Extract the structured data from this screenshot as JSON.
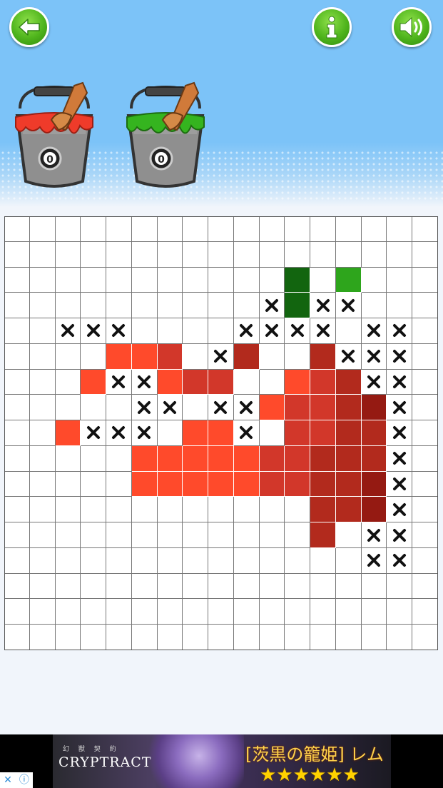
{
  "header": {
    "back_icon": "back-arrow-icon",
    "info_icon": "info-icon",
    "sound_icon": "speaker-icon"
  },
  "buckets": [
    {
      "name": "red-paint-bucket",
      "paint_color": "#ef3b2a",
      "label": "0"
    },
    {
      "name": "green-paint-bucket",
      "paint_color": "#35b41f",
      "label": "0"
    }
  ],
  "board": {
    "rows": 17,
    "cols": 17,
    "cell_colors": [
      [
        "",
        "",
        "",
        "",
        "",
        "",
        "",
        "",
        "",
        "",
        "",
        "",
        "",
        "",
        "",
        "",
        ""
      ],
      [
        "",
        "",
        "",
        "",
        "",
        "",
        "",
        "",
        "",
        "",
        "",
        "",
        "",
        "",
        "",
        "",
        ""
      ],
      [
        "",
        "",
        "",
        "",
        "",
        "",
        "",
        "",
        "",
        "",
        "",
        "g1",
        "",
        "g2",
        "",
        "",
        ""
      ],
      [
        "",
        "",
        "",
        "",
        "",
        "",
        "",
        "",
        "",
        "",
        "x",
        "g1",
        "x",
        "x",
        "",
        "",
        ""
      ],
      [
        "",
        "",
        "x",
        "x",
        "x",
        "",
        "",
        "",
        "",
        "x",
        "x",
        "x",
        "x",
        "",
        "x",
        "x",
        ""
      ],
      [
        "",
        "",
        "",
        "",
        "r1",
        "r1",
        "r2",
        "",
        "x",
        "r3",
        "",
        "",
        "r3",
        "x",
        "x",
        "x",
        ""
      ],
      [
        "",
        "",
        "",
        "r1",
        "x",
        "x",
        "r1",
        "r2",
        "r2",
        "",
        "",
        "r1",
        "r2",
        "r3",
        "x",
        "x",
        ""
      ],
      [
        "",
        "",
        "",
        "",
        "",
        "x",
        "x",
        "",
        "x",
        "x",
        "r1",
        "r2",
        "r2",
        "r3",
        "r4",
        "x",
        ""
      ],
      [
        "",
        "",
        "r1",
        "x",
        "x",
        "x",
        "",
        "r1",
        "r1",
        "x",
        "",
        "r2",
        "r2",
        "r3",
        "r3",
        "x",
        ""
      ],
      [
        "",
        "",
        "",
        "",
        "",
        "r1",
        "r1",
        "r1",
        "r1",
        "r1",
        "r2",
        "r2",
        "r3",
        "r3",
        "r3",
        "x",
        ""
      ],
      [
        "",
        "",
        "",
        "",
        "",
        "r1",
        "r1",
        "r1",
        "r1",
        "r1",
        "r2",
        "r2",
        "r3",
        "r3",
        "r4",
        "x",
        ""
      ],
      [
        "",
        "",
        "",
        "",
        "",
        "",
        "",
        "",
        "",
        "",
        "",
        "",
        "r3",
        "r3",
        "r4",
        "x",
        ""
      ],
      [
        "",
        "",
        "",
        "",
        "",
        "",
        "",
        "",
        "",
        "",
        "",
        "",
        "r3",
        "",
        "x",
        "x",
        ""
      ],
      [
        "",
        "",
        "",
        "",
        "",
        "",
        "",
        "",
        "",
        "",
        "",
        "",
        "",
        "",
        "x",
        "x",
        ""
      ],
      [
        "",
        "",
        "",
        "",
        "",
        "",
        "",
        "",
        "",
        "",
        "",
        "",
        "",
        "",
        "",
        "",
        ""
      ],
      [
        "",
        "",
        "",
        "",
        "",
        "",
        "",
        "",
        "",
        "",
        "",
        "",
        "",
        "",
        "",
        "",
        ""
      ],
      [
        "",
        "",
        "",
        "",
        "",
        "",
        "",
        "",
        "",
        "",
        "",
        "",
        "",
        "",
        "",
        "",
        ""
      ]
    ],
    "palette": {
      "r1": "#ff4a2b",
      "r2": "#d2372a",
      "r3": "#b22a1d",
      "r4": "#951a12",
      "g1": "#12650f",
      "g2": "#2ea51c"
    }
  },
  "ad": {
    "logo_sub": "幻 獣 契 約",
    "logo": "CRYPTRACT",
    "title": "[茨黒の籠姫] レム",
    "stars": "★★★★★★",
    "badge_close_icon": "close-icon",
    "badge_info_icon": "adchoices-info-icon"
  }
}
